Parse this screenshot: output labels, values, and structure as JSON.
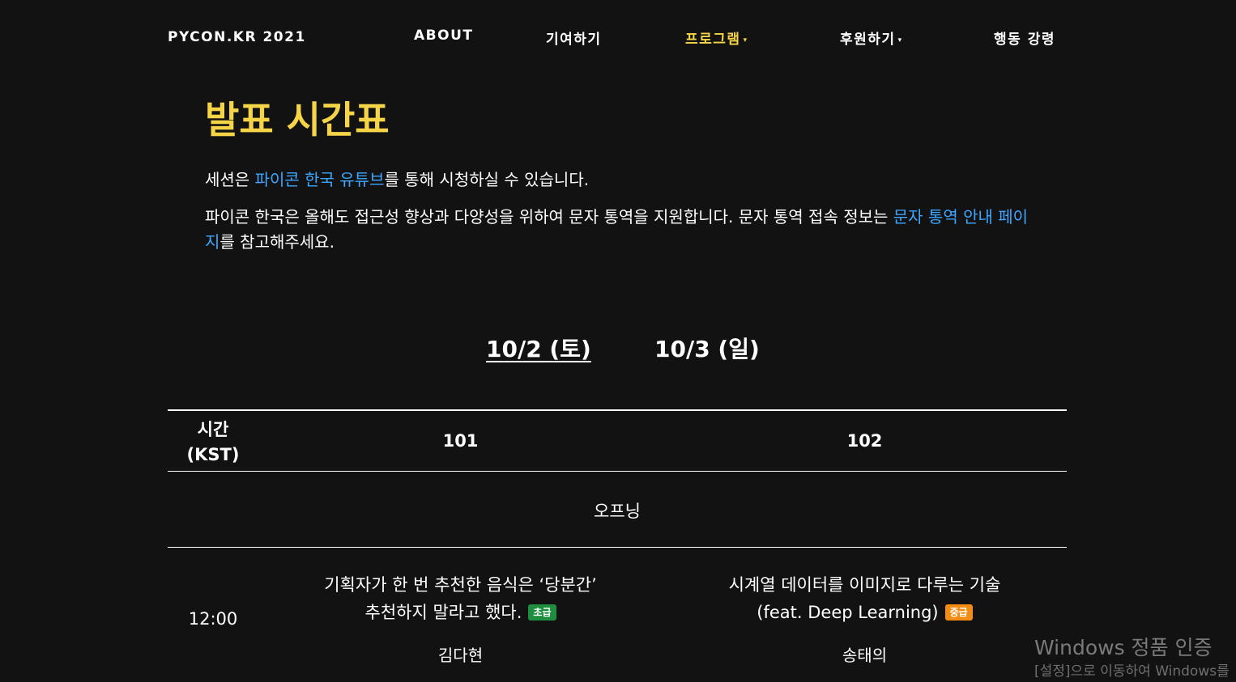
{
  "nav": {
    "brand": "PYCON.KR 2021",
    "items": [
      {
        "label": "ABOUT"
      },
      {
        "label": "기여하기"
      },
      {
        "label": "프로그램"
      },
      {
        "label": "후원하기"
      },
      {
        "label": "행동 강령"
      }
    ],
    "active_color": "#f5d547",
    "caret": "▾"
  },
  "page_title": "발표 시간표",
  "intro": {
    "p1_before": "세션은 ",
    "p1_link": "파이콘 한국 유튜브",
    "p1_after": "를 통해 시청하실 수 있습니다.",
    "p2_before": "파이콘 한국은 올해도 접근성 향상과 다양성을 위하여 문자 통역을 지원합니다. 문자 통역 접속 정보는 ",
    "p2_link": "문자 통역 안내 페이지",
    "p2_after": "를 참고해주세요."
  },
  "days": [
    {
      "label": "10/2 (토)",
      "active": true
    },
    {
      "label": "10/3 (일)",
      "active": false
    }
  ],
  "table": {
    "headers": {
      "time_line1": "시간",
      "time_line2": "(KST)",
      "room1": "101",
      "room2": "102"
    },
    "opening": "오프닝",
    "rows": [
      {
        "time": "12:00",
        "room1": {
          "title_line1": "기획자가 한 번 추천한 음식은 ‘당분간’",
          "title_line2": "추천하지 말라고 했다.",
          "level": "초급",
          "speaker": "김다현"
        },
        "room2": {
          "title_line1": "시계열 데이터를 이미지로 다루는 기술",
          "title_line2": "(feat. Deep Learning)",
          "level": "중급",
          "speaker": "송태의"
        }
      }
    ]
  },
  "level_colors": {
    "초급": "#1e8e3e",
    "중급": "#f28c13"
  },
  "watermark": {
    "line1": "Windows 정품 인증",
    "line2": "[설정]으로 이동하여 Windows를"
  }
}
